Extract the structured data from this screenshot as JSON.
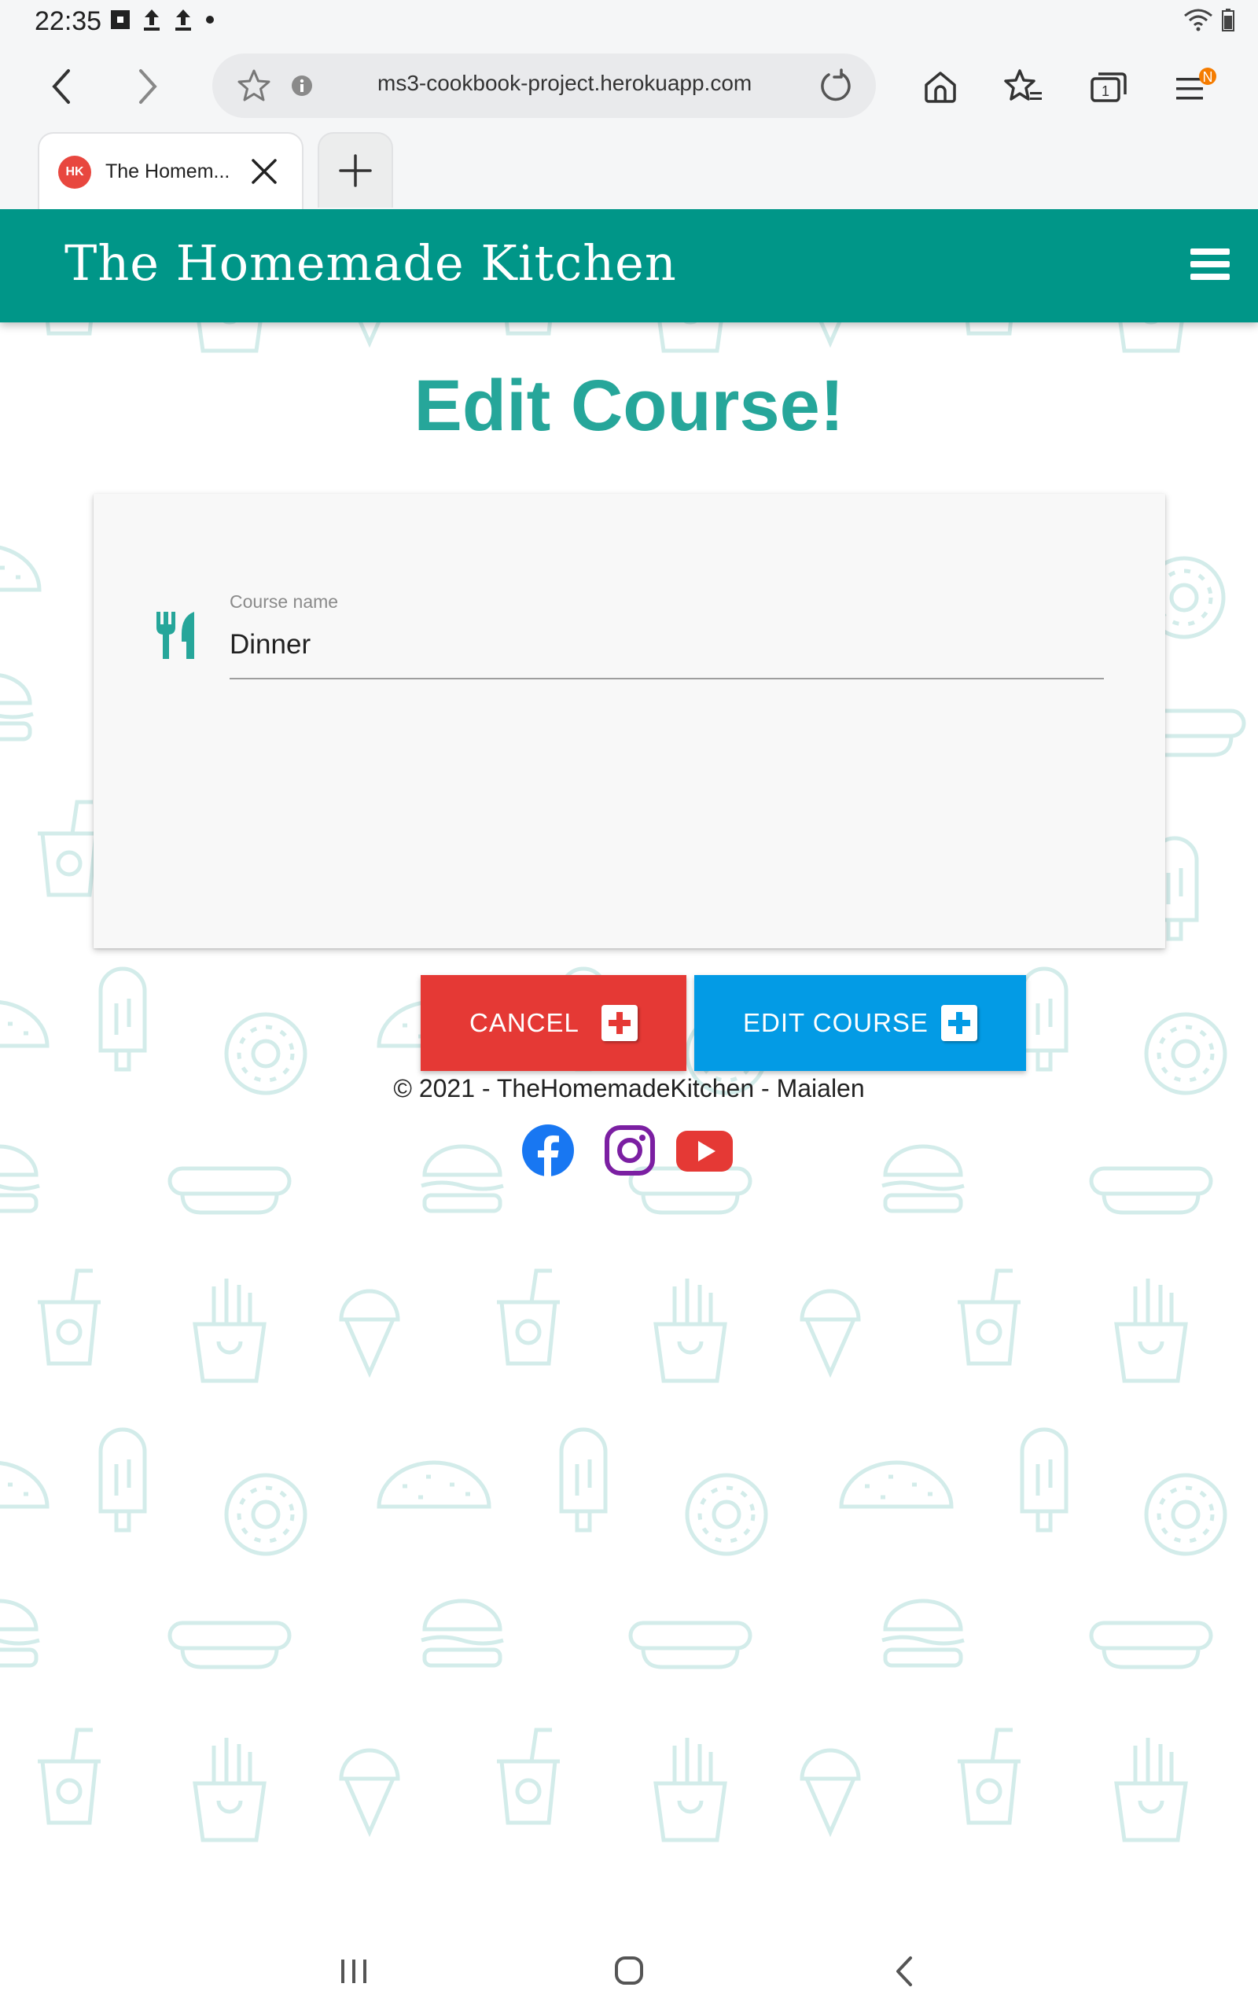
{
  "status_bar": {
    "time": "22:35",
    "icons": [
      "flipboard-icon",
      "upload-icon",
      "upload-icon",
      "dot-icon"
    ],
    "right_icons": [
      "wifi-icon",
      "battery-icon"
    ]
  },
  "browser": {
    "url": "ms3-cookbook-project.herokuapp.com",
    "tab_title": "The Homem...",
    "tab_favicon_text": "HK",
    "tabs_count": "1",
    "menu_badge": "N"
  },
  "site": {
    "brand": "The Homemade Kitchen",
    "heading": "Edit Course!",
    "form": {
      "label": "Course name",
      "value": "Dinner",
      "icon": "utensils-icon"
    },
    "buttons": {
      "cancel": "CANCEL",
      "edit": "EDIT COURSE"
    },
    "footer": "© 2021 - TheHomemadeKitchen - Maialen",
    "socials": [
      "facebook-icon",
      "instagram-icon",
      "youtube-icon"
    ]
  },
  "colors": {
    "header": "#009688",
    "heading": "#26a69a",
    "cancel": "#e53935",
    "edit": "#039be5",
    "pattern": "#d9f0ee"
  }
}
